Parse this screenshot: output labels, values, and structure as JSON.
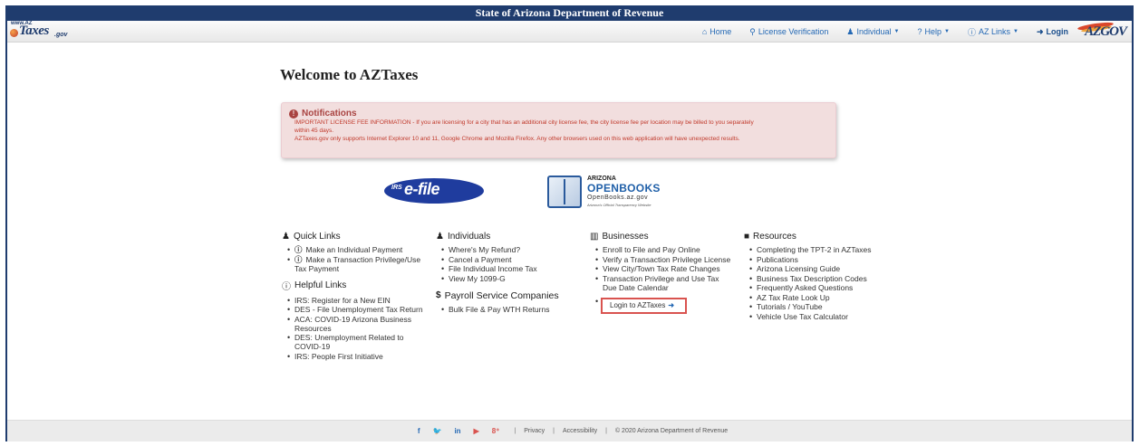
{
  "topbar": {
    "title": "State of Arizona Department of Revenue"
  },
  "logo": {
    "www": "www.AZ",
    "word": "Taxes",
    "gov": ".gov"
  },
  "nav": {
    "home": "Home",
    "license": "License Verification",
    "individual": "Individual",
    "help": "Help",
    "azlinks": "AZ Links",
    "login": "Login"
  },
  "azgov": {
    "text": "AZGOV"
  },
  "page": {
    "title": "Welcome to AZTaxes"
  },
  "notifications": {
    "title": "Notifications",
    "line1": "IMPORTANT LICENSE FEE INFORMATION - If you are licensing for a city that has an additional city license fee, the city license fee per location may be billed to you separately",
    "line2": "within 45 days.",
    "line3": "AZTaxes.gov only supports Internet Explorer 10 and 11, Google Chrome and Mozilla Firefox. Any other browsers used on this web application will have unexpected results."
  },
  "efile": {
    "irs": "IRS",
    "text": "e-file"
  },
  "openbooks": {
    "l1": "ARIZONA",
    "l2": "OPENBOOKS",
    "l3": "OpenBooks.az.gov",
    "l4": "Arizona's Official Transparency Website"
  },
  "quick_links": {
    "title": "Quick Links",
    "items": [
      "Make an Individual Payment",
      "Make a Transaction Privilege/Use Tax Payment"
    ]
  },
  "helpful_links": {
    "title": "Helpful Links",
    "items": [
      "IRS: Register for a New EIN",
      "DES - File Unemployment Tax Return",
      "ACA: COVID-19 Arizona Business Resources",
      "DES: Unemployment Related to COVID-19",
      "IRS: People First Initiative"
    ]
  },
  "individuals": {
    "title": "Individuals",
    "items": [
      "Where's My Refund?",
      "Cancel a Payment",
      "File Individual Income Tax",
      "View My 1099-G"
    ]
  },
  "payroll": {
    "title": "Payroll Service Companies",
    "items": [
      "Bulk File & Pay WTH Returns"
    ]
  },
  "businesses": {
    "title": "Businesses",
    "items": [
      "Enroll to File and Pay Online",
      "Verify a Transaction Privilege License",
      "View City/Town Tax Rate Changes",
      "Transaction Privilege and Use Tax Due Date Calendar"
    ],
    "login": "Login to AZTaxes"
  },
  "resources": {
    "title": "Resources",
    "items": [
      "Completing the TPT-2 in AZTaxes",
      "Publications",
      "Arizona Licensing Guide",
      "Business Tax Description Codes",
      "Frequently Asked Questions",
      "AZ Tax Rate Look Up",
      "Tutorials / YouTube",
      "Vehicle Use Tax Calculator"
    ]
  },
  "footer": {
    "privacy": "Privacy",
    "accessibility": "Accessibility",
    "copyright": "© 2020 Arizona Department of Revenue"
  },
  "icons": {
    "home": "home-icon",
    "search": "search-icon",
    "user": "user-icon",
    "help": "question-circle-icon",
    "info": "info-circle-icon",
    "login": "sign-in-icon",
    "chart": "bar-chart-icon",
    "book": "book-icon",
    "dollar": "dollar-icon"
  },
  "colors": {
    "navy": "#1f3c6e",
    "link": "#2468b4",
    "alert": "#a94442",
    "alert_bg": "#f2dede"
  }
}
